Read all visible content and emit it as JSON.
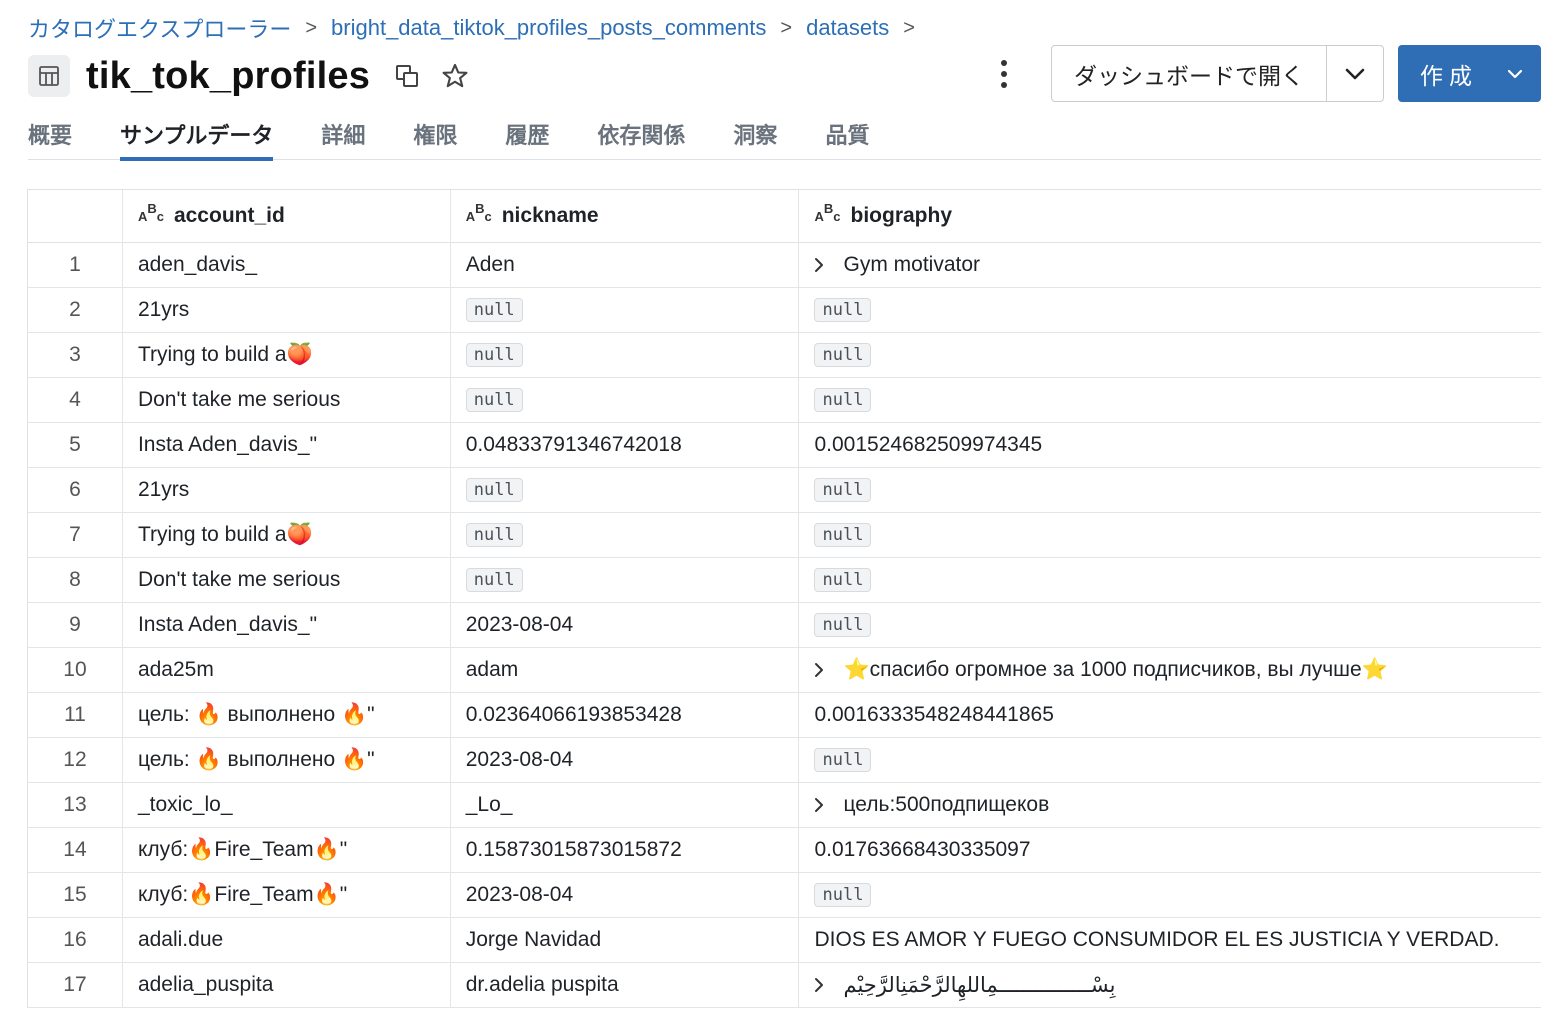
{
  "breadcrumb": {
    "items": [
      "カタログエクスプローラー",
      "bright_data_tiktok_profiles_posts_comments",
      "datasets"
    ],
    "separator": ">"
  },
  "header": {
    "title": "tik_tok_profiles",
    "table_icon": "table-icon",
    "copy_icon": "copy-icon",
    "star_icon": "star-icon"
  },
  "actions": {
    "dashboard_label": "ダッシュボードで開く",
    "create_label": "作成",
    "accent_color": "#2f6db5"
  },
  "tabs": [
    {
      "label": "概要",
      "active": false
    },
    {
      "label": "サンプルデータ",
      "active": true
    },
    {
      "label": "詳細",
      "active": false
    },
    {
      "label": "権限",
      "active": false
    },
    {
      "label": "履歴",
      "active": false
    },
    {
      "label": "依存関係",
      "active": false
    },
    {
      "label": "洞察",
      "active": false
    },
    {
      "label": "品質",
      "active": false
    }
  ],
  "table": {
    "type_icon_label": {
      "a": "A",
      "b": "B",
      "c": "c"
    },
    "columns": [
      "account_id",
      "nickname",
      "biography"
    ],
    "null_label": "null",
    "rows": [
      {
        "num": "1",
        "account_id": "aden_davis_",
        "nickname": "Aden",
        "biography": "Gym motivator",
        "bio_expandable": true
      },
      {
        "num": "2",
        "account_id": "21yrs",
        "nickname": null,
        "biography": null,
        "bio_expandable": false
      },
      {
        "num": "3",
        "account_id": "Trying to build a🍑",
        "nickname": null,
        "biography": null,
        "bio_expandable": false
      },
      {
        "num": "4",
        "account_id": "Don't take me serious",
        "nickname": null,
        "biography": null,
        "bio_expandable": false
      },
      {
        "num": "5",
        "account_id": "Insta Aden_davis_\"",
        "nickname": "0.04833791346742018",
        "biography": "0.001524682509974345",
        "bio_expandable": false
      },
      {
        "num": "6",
        "account_id": "21yrs",
        "nickname": null,
        "biography": null,
        "bio_expandable": false
      },
      {
        "num": "7",
        "account_id": "Trying to build a🍑",
        "nickname": null,
        "biography": null,
        "bio_expandable": false
      },
      {
        "num": "8",
        "account_id": "Don't take me serious",
        "nickname": null,
        "biography": null,
        "bio_expandable": false
      },
      {
        "num": "9",
        "account_id": "Insta Aden_davis_\"",
        "nickname": "2023-08-04",
        "biography": null,
        "bio_expandable": false
      },
      {
        "num": "10",
        "account_id": "ada25m",
        "nickname": "adam",
        "biography": "⭐спасибо огромное за 1000 подписчиков, вы лучше⭐",
        "bio_expandable": true
      },
      {
        "num": "11",
        "account_id": "цель: 🔥 выполнено 🔥\"",
        "nickname": "0.02364066193853428",
        "biography": "0.0016333548248441865",
        "bio_expandable": false
      },
      {
        "num": "12",
        "account_id": "цель: 🔥 выполнено 🔥\"",
        "nickname": "2023-08-04",
        "biography": null,
        "bio_expandable": false
      },
      {
        "num": "13",
        "account_id": "_toxic_lo_",
        "nickname": "_Lo_",
        "biography": "цель:500подпищеков",
        "bio_expandable": true
      },
      {
        "num": "14",
        "account_id": "клуб:🔥Fire_Team🔥\"",
        "nickname": "0.15873015873015872",
        "biography": "0.01763668430335097",
        "bio_expandable": false
      },
      {
        "num": "15",
        "account_id": "клуб:🔥Fire_Team🔥\"",
        "nickname": "2023-08-04",
        "biography": null,
        "bio_expandable": false
      },
      {
        "num": "16",
        "account_id": "adali.due",
        "nickname": "Jorge Navidad",
        "biography": "DIOS ES AMOR Y FUEGO CONSUMIDOR EL ES JUSTICIA Y VERDAD.",
        "bio_expandable": false
      },
      {
        "num": "17",
        "account_id": "adelia_puspita",
        "nickname": "dr.adelia puspita",
        "biography": "بِسْـــــــــــــــمِاللهِالرَّحْمَنِالرَّحِيْم",
        "bio_expandable": true,
        "bio_rtl": true
      }
    ]
  }
}
